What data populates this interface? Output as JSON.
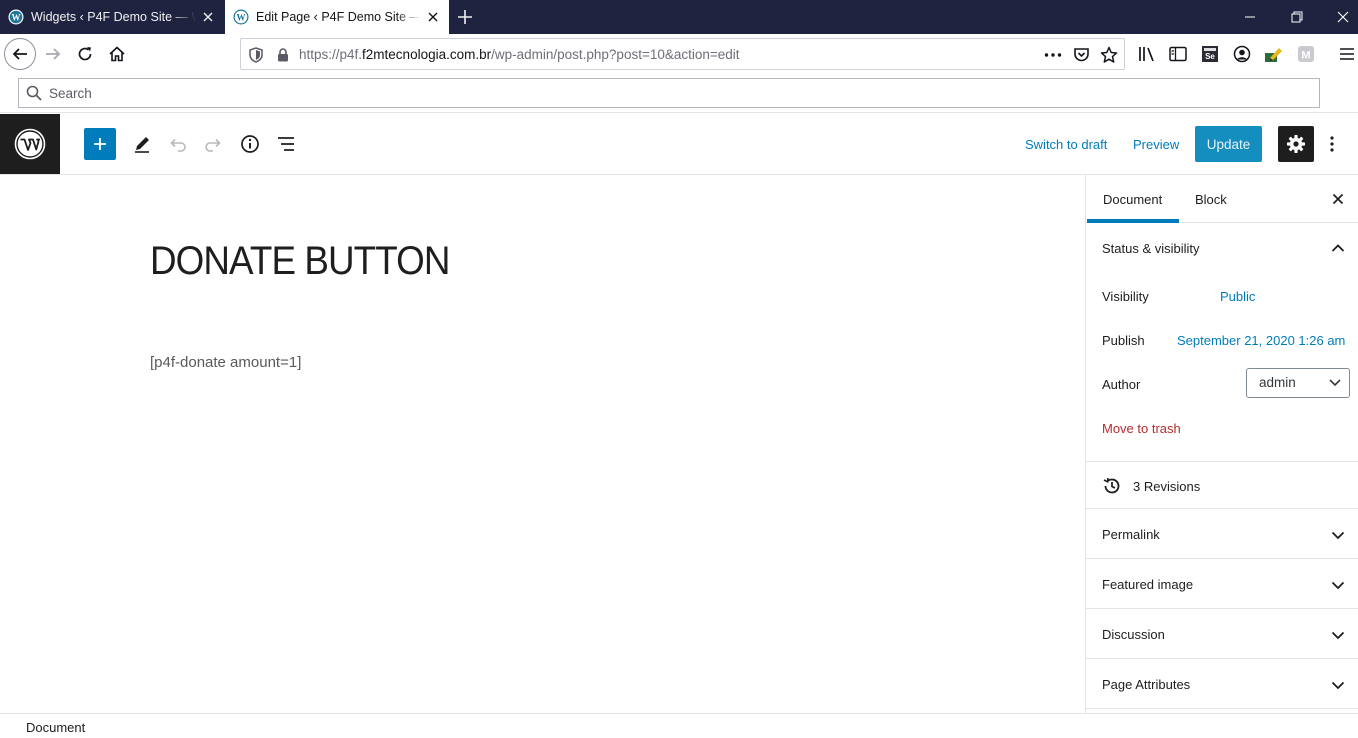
{
  "browser": {
    "tabs": [
      {
        "title": "Widgets ‹ P4F Demo Site — WordPress",
        "active": false
      },
      {
        "title": "Edit Page ‹ P4F Demo Site — WordPress",
        "active": true
      }
    ],
    "url_prefix": "https://p4f.",
    "url_domain": "f2mtecnologia.com.br",
    "url_path": "/wp-admin/post.php?post=10&action=edit",
    "search_placeholder": "Search"
  },
  "editor": {
    "header": {
      "switch_to_draft": "Switch to draft",
      "preview": "Preview",
      "update": "Update"
    },
    "post": {
      "title": "DONATE BUTTON",
      "body": "[p4f-donate amount=1]"
    },
    "sidebar": {
      "tabs": [
        "Document",
        "Block"
      ],
      "status_visibility": {
        "heading": "Status & visibility",
        "visibility_label": "Visibility",
        "visibility_value": "Public",
        "publish_label": "Publish",
        "publish_value": "September 21, 2020 1:26 am",
        "author_label": "Author",
        "author_value": "admin",
        "trash": "Move to trash"
      },
      "revisions": "3 Revisions",
      "panels": [
        "Permalink",
        "Featured image",
        "Discussion",
        "Page Attributes"
      ]
    },
    "footer": {
      "breadcrumb": "Document"
    }
  },
  "colors": {
    "tabstrip": "#202340",
    "wp_blue": "#007cba",
    "trash_red": "#b32d2e",
    "dark": "#1e1e1e"
  }
}
